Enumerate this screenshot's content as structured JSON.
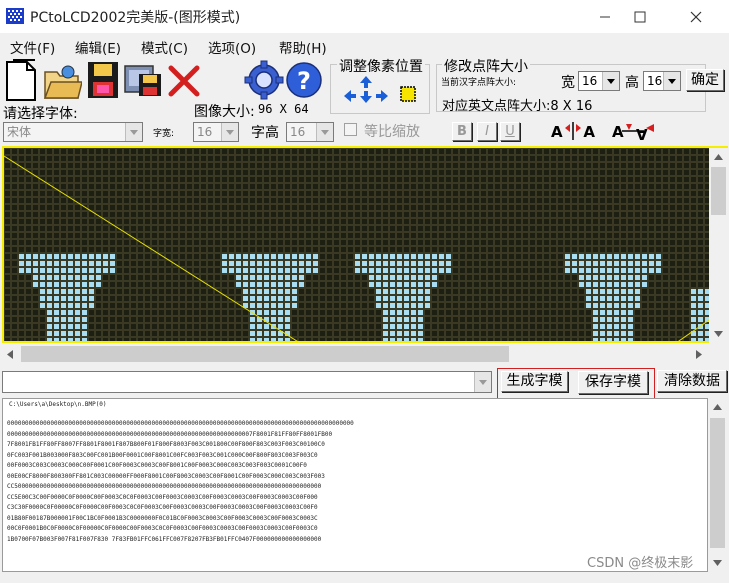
{
  "window": {
    "title": "PCtoLCD2002完美版-(图形模式)"
  },
  "menu": [
    "文件(F)",
    "编辑(E)",
    "模式(C)",
    "选项(O)",
    "帮助(H)"
  ],
  "toolbar": {
    "adjust_pixel_label": "调整像素位置",
    "modify_matrix_label": "修改点阵大小",
    "current_cn_matrix_label": "当前汉字点阵大小:",
    "width_label": "宽",
    "width_value": "16",
    "height_label": "高",
    "height_value": "16",
    "confirm_button": "确定",
    "en_matrix_label": "对应英文点阵大小:8 X 16",
    "image_size_label": "图像大小:",
    "image_size_value": "96 X 64",
    "select_font_label": "请选择字体:",
    "font_value": "宋体",
    "char_width_label": "字宽:",
    "char_width_value": "16",
    "char_height_label": "字高",
    "char_height_value": "16",
    "proportional_label": "等比缩放",
    "bold_label": "B",
    "italic_label": "I",
    "underline_label": "U"
  },
  "actions": {
    "generate_button": "生成字模",
    "save_button": "保存字模",
    "clear_button": "清除数据"
  },
  "output": {
    "path_line": "C:\\Users\\a\\Desktop\\n.BMP(0)",
    "hex_lines": [
      "000000000000000000000000000000000000000000000000000000000000000000000000000000000000000000000000",
      "00000000000000000000000000000000000000000000000000000000000000000007F8001F81FF80FF8001FB00",
      "7F8001FB1FF80FF8007FF8801F8001F807B800F01F800F8003F003C001800C00F800F803C003F003C00100C0",
      "0FC003F001B003000F803C00FC001B00F0001C00F8001C00FC003F003C001C000C00F800F803C003F003C0",
      "00F0003C003C0003C000C00F0001C00F0003C0003C00F8001C00F0003C000C003C003F003C0001C00F0",
      "00E00CF8000F800300FF801C003C00000FF000F8001C00F8003C0003C00F8001C00F0003C000C003C003F003",
      "CC5000000000000000000000000000000000000000000000000000000000000000000000000000000000000",
      "CC5E00C3C00F0000C0F0000C00F0003C0C0F0003C00F0003C0003C00F0003C0003C00F0003C0003C00F000",
      "C3C30F0000C0F00000C0F0000C00F0003C0C0F0003C00F0003C0003C00F0003C0003C00F0003C0003C00F0",
      "01B80F00187B000001F00C1BC0F0001B3C0000000F0C01BC0F0003C0003C00F0003C0003C00F0003C0003C",
      "00C0F0001B0C0F0000C0F00000C0F0000C00F0003C0C0F0003C00F0003C0003C00F0003C0003C00F0003C0",
      "1B0700F07B003F007F81F007F830 7F83FB01FFC061FFC007F8207FB3FB01FFC0407F000000000000000000"
    ]
  },
  "watermark": "CSDN @终极末影龙"
}
